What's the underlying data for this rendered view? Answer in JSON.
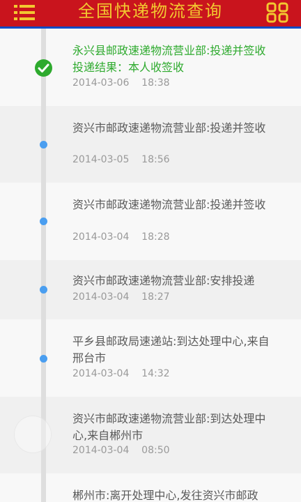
{
  "header": {
    "title": "全国快递物流查询",
    "bg_color": "#c9141d",
    "title_color": "#f2c830",
    "menu_icon": "list-icon",
    "grid_icon": "grid-icon"
  },
  "timeline": {
    "events": [
      {
        "text": "永兴县邮政速递物流营业部:投递并签收 投递结果：本人收签收",
        "time": "2014-03-06    18:38",
        "status": "delivered"
      },
      {
        "text": "资兴市邮政速递物流营业部:投递并签收",
        "time": "2014-03-05    18:56"
      },
      {
        "text": "资兴市邮政速递物流营业部:投递并签收",
        "time": "2014-03-04    18:28"
      },
      {
        "text": "资兴市邮政速递物流营业部:安排投递",
        "time": "2014-03-04    18:27"
      },
      {
        "text": "平乡县邮政局速递站:到达处理中心,来自邢台市",
        "time": "2014-03-04    14:32"
      },
      {
        "text": "资兴市邮政速递物流营业部:到达处理中心,来自郴州市",
        "time": "2014-03-04    08:50"
      },
      {
        "text": "郴州市:离开处理中心,发往资兴市邮政",
        "time": ""
      }
    ],
    "delivered_color": "#2eaa2e",
    "dot_color": "#4a9ef0"
  }
}
